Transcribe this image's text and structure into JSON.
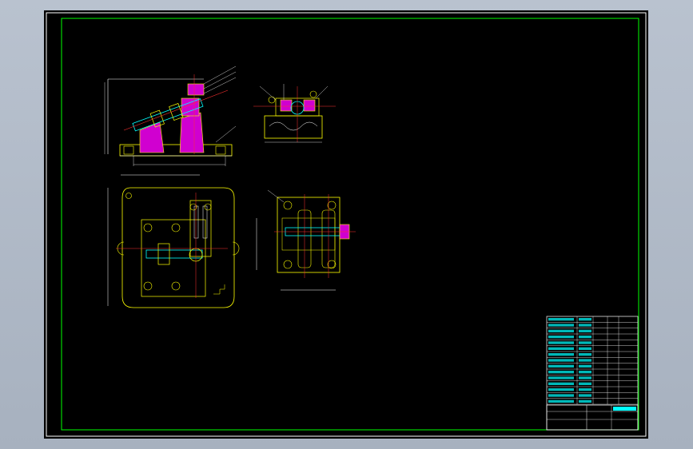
{
  "drawing": {
    "background": "#000000",
    "border_color": "#00ff00",
    "line_colors": {
      "outline": "#ffff00",
      "centerline": "#ff3030",
      "section": "#ff00ff",
      "dimension": "#ffffff",
      "hidden": "#00ffff"
    }
  },
  "views": [
    {
      "id": "front-view"
    },
    {
      "id": "side-view"
    },
    {
      "id": "top-view"
    },
    {
      "id": "detail-view"
    }
  ],
  "title_block": {
    "bom_rows": 15,
    "bom_columns": 5
  }
}
